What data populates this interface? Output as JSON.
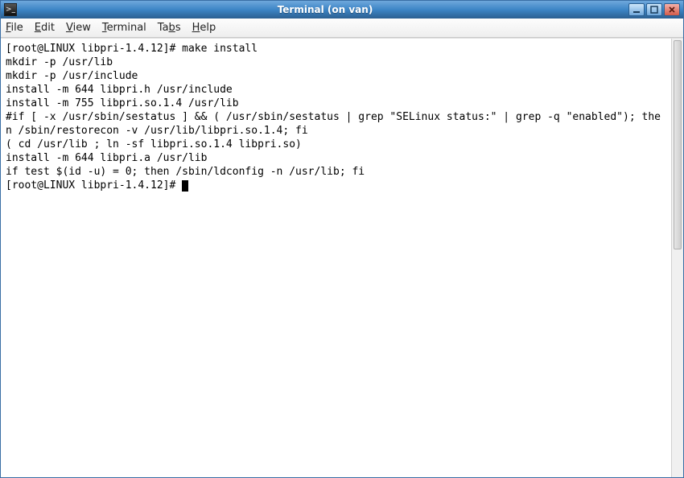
{
  "titlebar": {
    "title": "Terminal (on van)"
  },
  "menubar": {
    "file": "File",
    "edit": "Edit",
    "view": "View",
    "terminal": "Terminal",
    "tabs": "Tabs",
    "help": "Help"
  },
  "terminal": {
    "lines": [
      "[root@LINUX libpri-1.4.12]# make install",
      "mkdir -p /usr/lib",
      "mkdir -p /usr/include",
      "install -m 644 libpri.h /usr/include",
      "install -m 755 libpri.so.1.4 /usr/lib",
      "#if [ -x /usr/sbin/sestatus ] && ( /usr/sbin/sestatus | grep \"SELinux status:\" | grep -q \"enabled\"); then /sbin/restorecon -v /usr/lib/libpri.so.1.4; fi",
      "( cd /usr/lib ; ln -sf libpri.so.1.4 libpri.so)",
      "install -m 644 libpri.a /usr/lib",
      "if test $(id -u) = 0; then /sbin/ldconfig -n /usr/lib; fi",
      "[root@LINUX libpri-1.4.12]# "
    ]
  }
}
